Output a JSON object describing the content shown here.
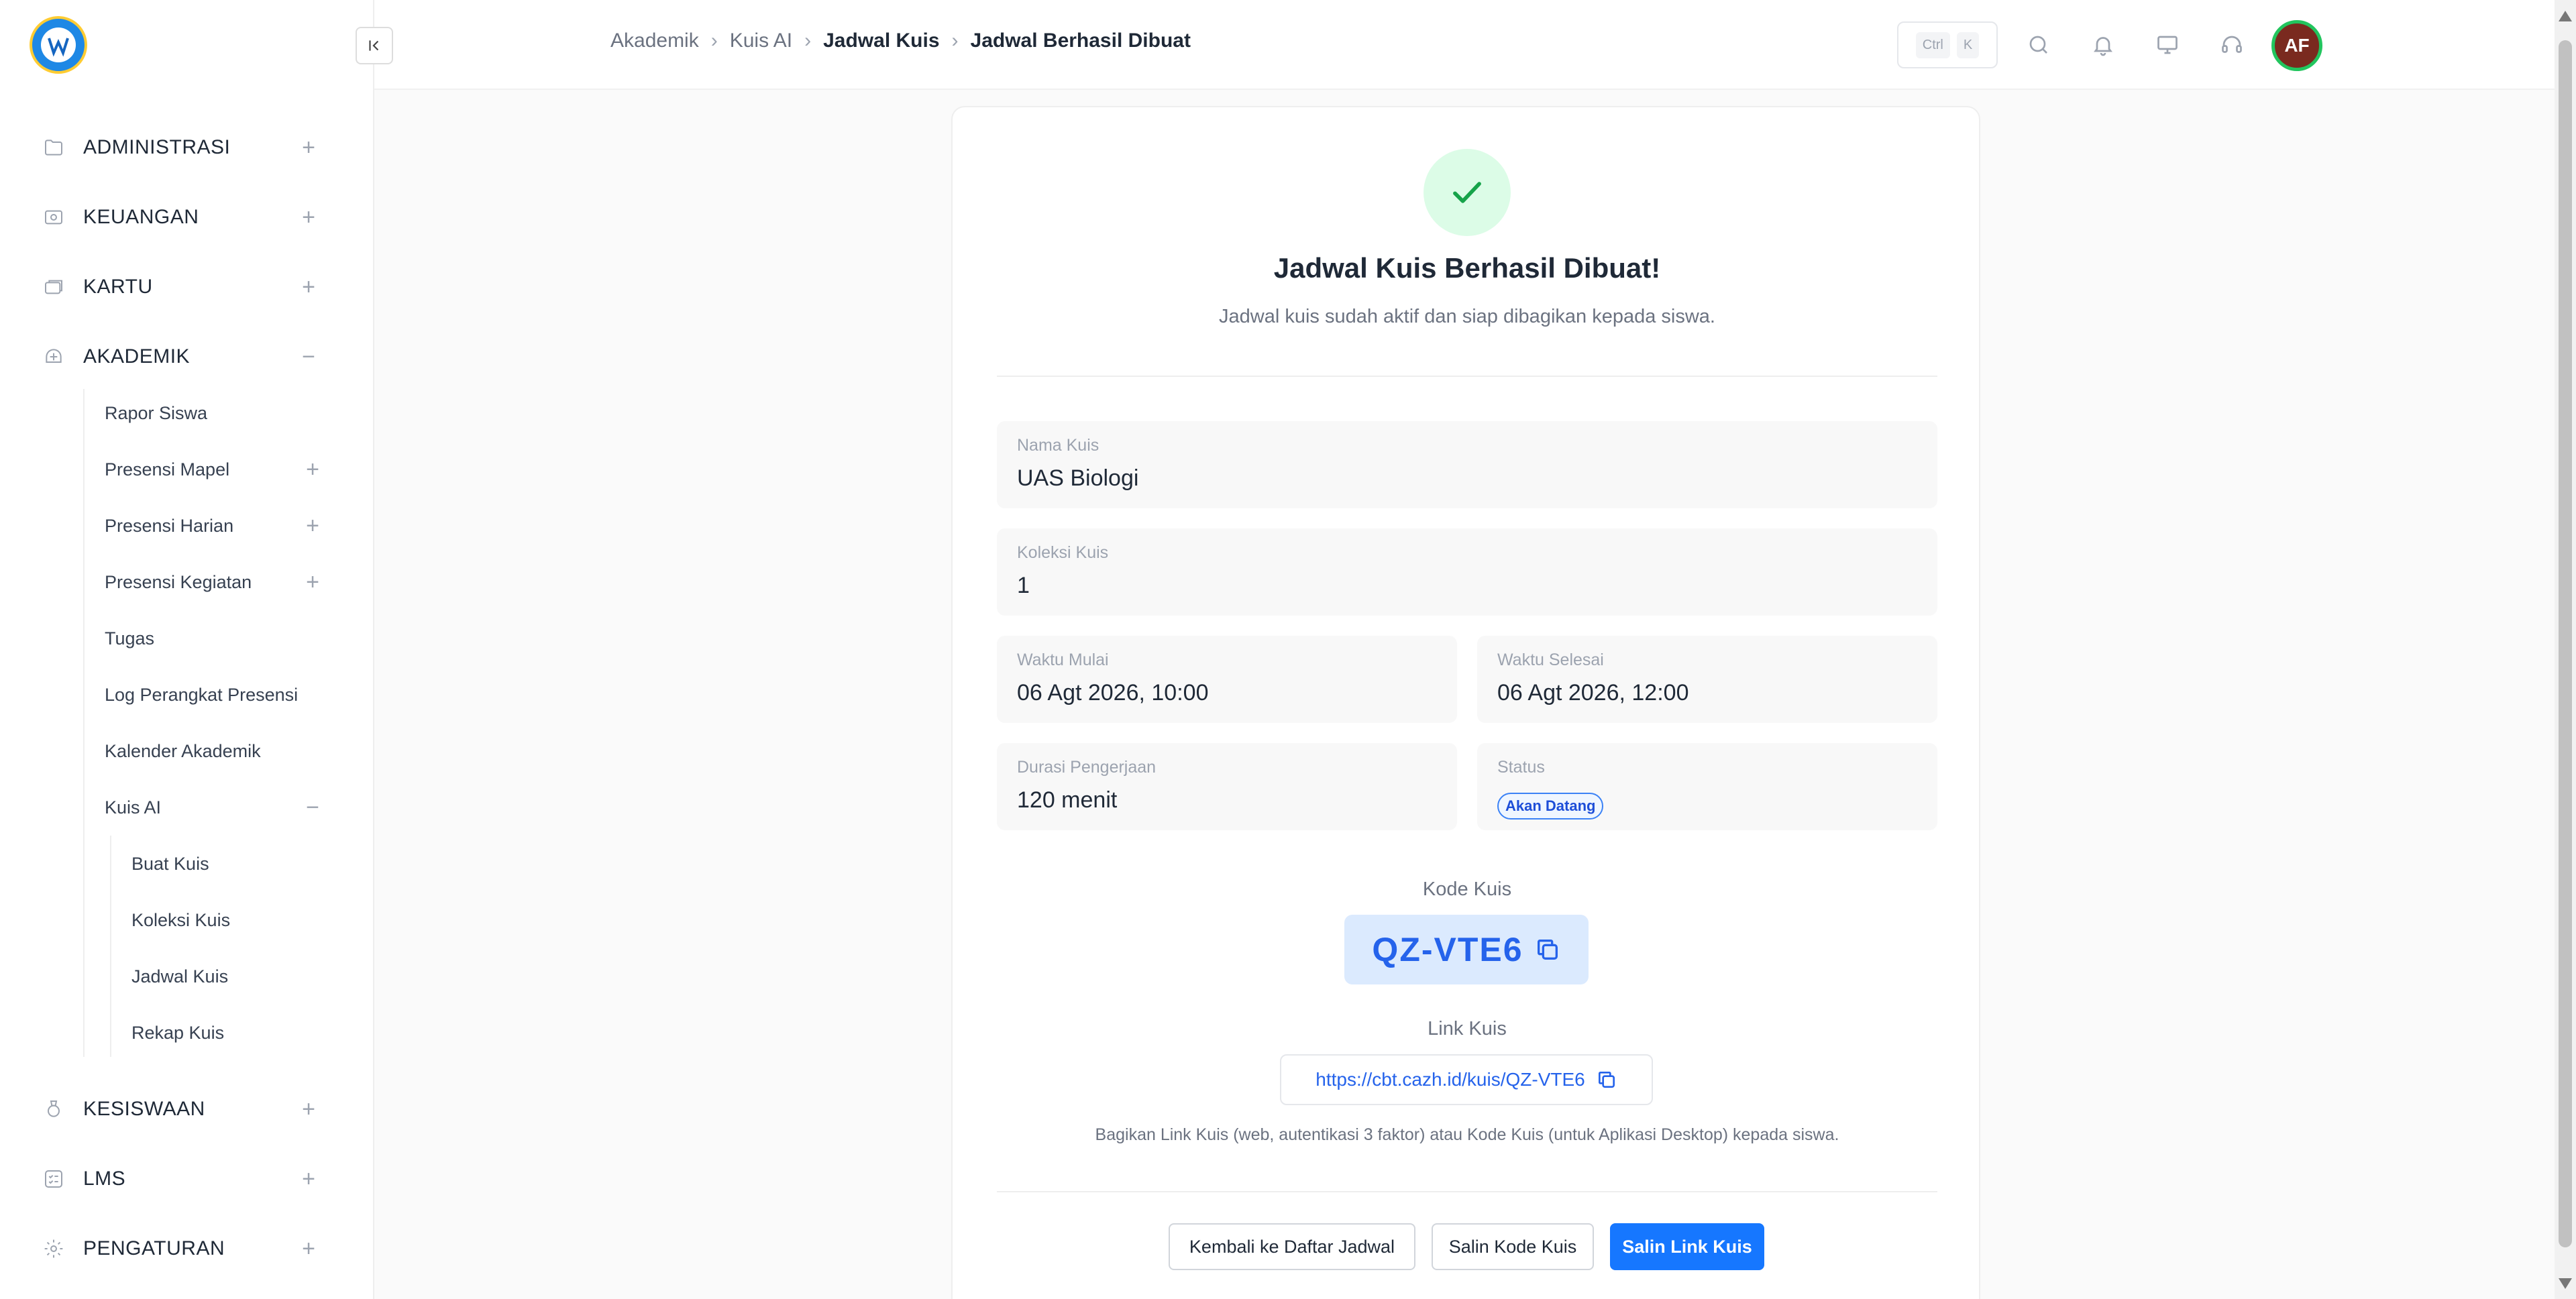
{
  "sidebar": {
    "items": [
      {
        "label": "ADMINISTRASI",
        "icon": "folder-icon",
        "toggle": "+"
      },
      {
        "label": "KEUANGAN",
        "icon": "money-icon",
        "toggle": "+"
      },
      {
        "label": "KARTU",
        "icon": "cards-icon",
        "toggle": "+"
      },
      {
        "label": "AKADEMIK",
        "icon": "academic-icon",
        "toggle": "−"
      },
      {
        "label": "KESISWAAN",
        "icon": "medal-icon",
        "toggle": "+"
      },
      {
        "label": "LMS",
        "icon": "checklist-icon",
        "toggle": "+"
      },
      {
        "label": "PENGATURAN",
        "icon": "gear-icon",
        "toggle": "+"
      }
    ],
    "akademik_children": [
      {
        "label": "Rapor Siswa",
        "toggle": ""
      },
      {
        "label": "Presensi Mapel",
        "toggle": "+"
      },
      {
        "label": "Presensi Harian",
        "toggle": "+"
      },
      {
        "label": "Presensi Kegiatan",
        "toggle": "+"
      },
      {
        "label": "Tugas",
        "toggle": ""
      },
      {
        "label": "Log Perangkat Presensi",
        "toggle": ""
      },
      {
        "label": "Kalender Akademik",
        "toggle": ""
      },
      {
        "label": "Kuis AI",
        "toggle": "−"
      }
    ],
    "kuis_children": [
      "Buat Kuis",
      "Koleksi Kuis",
      "Jadwal Kuis",
      "Rekap Kuis"
    ]
  },
  "header": {
    "breadcrumb": [
      "Akademik",
      "Kuis AI",
      "Jadwal Kuis",
      "Jadwal Berhasil Dibuat"
    ],
    "shortcut": [
      "Ctrl",
      "K"
    ],
    "avatar_initials": "AF"
  },
  "card": {
    "title": "Jadwal Kuis Berhasil Dibuat!",
    "subtitle": "Jadwal kuis sudah aktif dan siap dibagikan kepada siswa.",
    "fields": {
      "nama_label": "Nama Kuis",
      "nama_value": "UAS Biologi",
      "koleksi_label": "Koleksi Kuis",
      "koleksi_value": "1",
      "mulai_label": "Waktu Mulai",
      "mulai_value": "06 Agt 2026, 10:00",
      "selesai_label": "Waktu Selesai",
      "selesai_value": "06 Agt 2026, 12:00",
      "durasi_label": "Durasi Pengerjaan",
      "durasi_value": "120 menit",
      "status_label": "Status",
      "status_value": "Akan Datang"
    },
    "code_label": "Kode Kuis",
    "code_value": "QZ-VTE6",
    "link_label": "Link Kuis",
    "link_value": "https://cbt.cazh.id/kuis/QZ-VTE6",
    "hint": "Bagikan Link Kuis (web, autentikasi 3 faktor) atau Kode Kuis (untuk Aplikasi Desktop) kepada siswa.",
    "buttons": {
      "back": "Kembali ke Daftar Jadwal",
      "copy_code": "Salin Kode Kuis",
      "copy_link": "Salin Link Kuis"
    }
  },
  "colors": {
    "accent": "#1677ff",
    "success_bg": "#dcfce7",
    "success": "#16a34a"
  }
}
